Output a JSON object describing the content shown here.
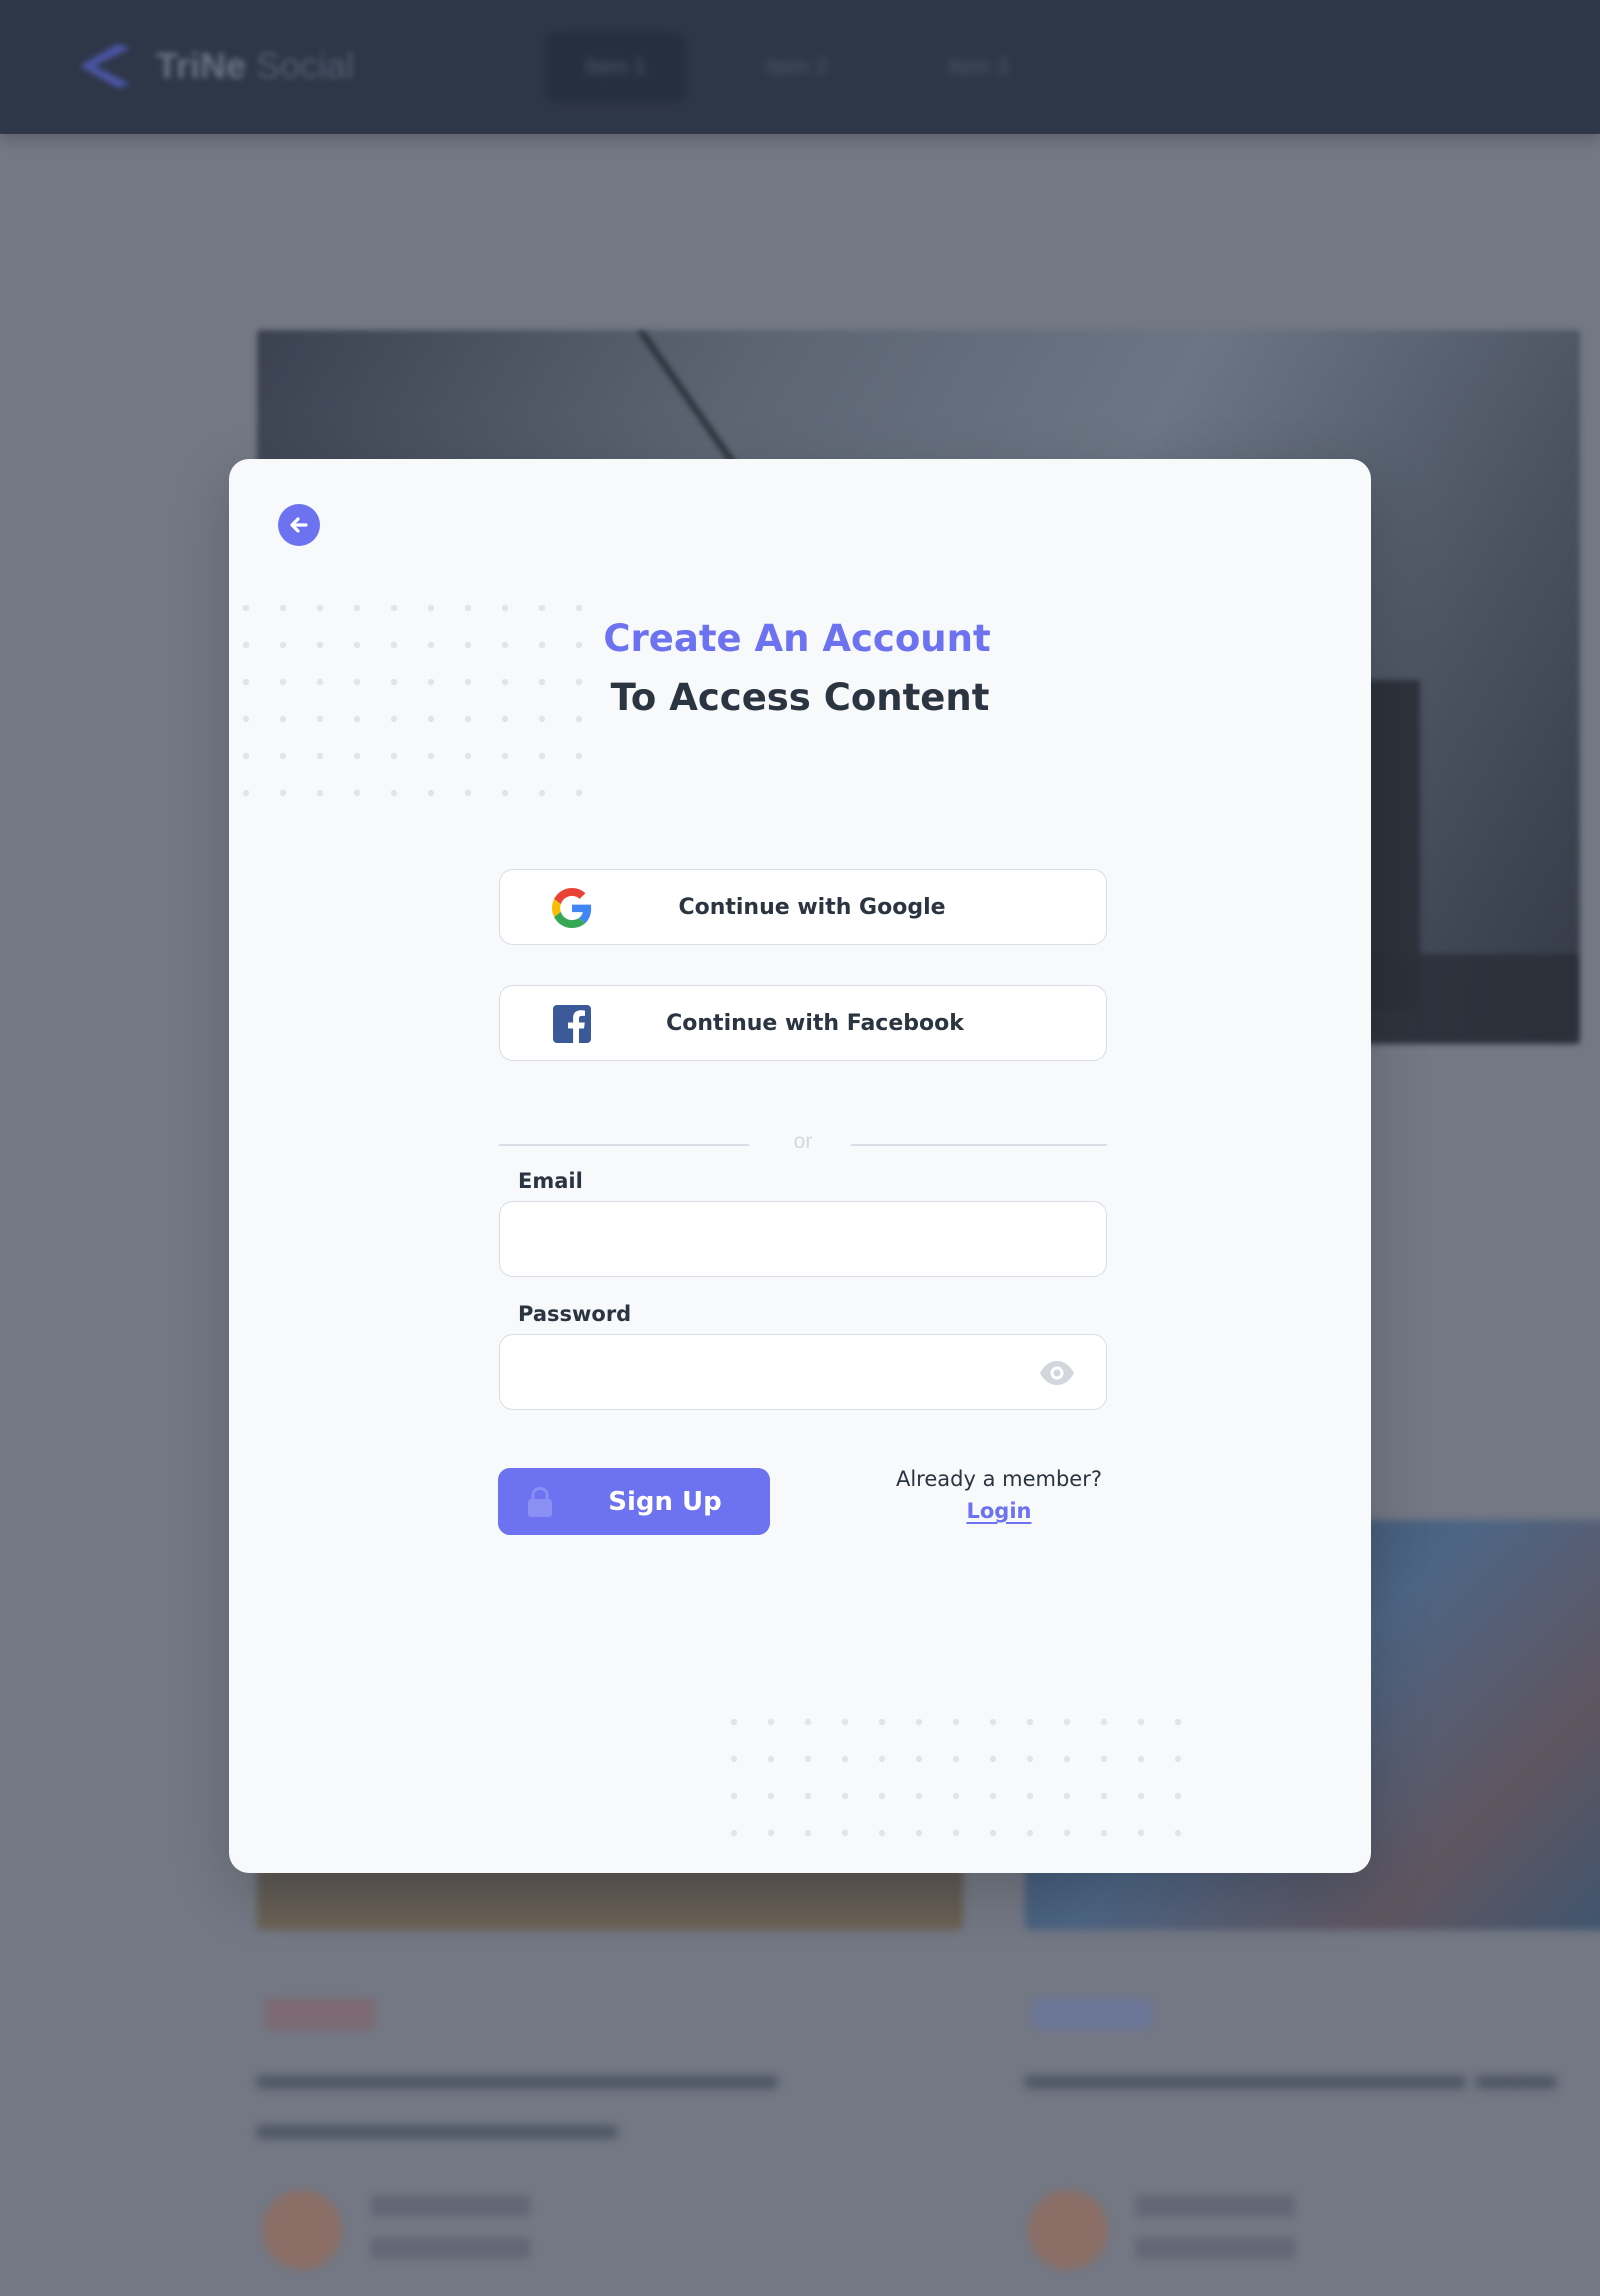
{
  "background": {
    "nav": {
      "logo_text": "TriNe",
      "logo_subtext": "Social",
      "items": [
        "Item 1",
        "Item 2",
        "Item 3"
      ]
    }
  },
  "modal": {
    "title_line1": "Create An Account",
    "title_line2": "To Access Content",
    "google_label": "Continue with Google",
    "facebook_label": "Continue with Facebook",
    "divider_text": "or",
    "email": {
      "label": "Email",
      "value": "",
      "placeholder": ""
    },
    "password": {
      "label": "Password",
      "value": "",
      "placeholder": ""
    },
    "signup_label": "Sign Up",
    "member_text": "Already a member?",
    "login_label": "Login"
  },
  "colors": {
    "accent": "#6c72f0",
    "text_dark": "#2b3441",
    "modal_bg": "#f7f9fb",
    "overlay": "#737884"
  },
  "icons": [
    "back-arrow-icon",
    "google-icon",
    "facebook-icon",
    "eye-icon",
    "lock-icon"
  ]
}
